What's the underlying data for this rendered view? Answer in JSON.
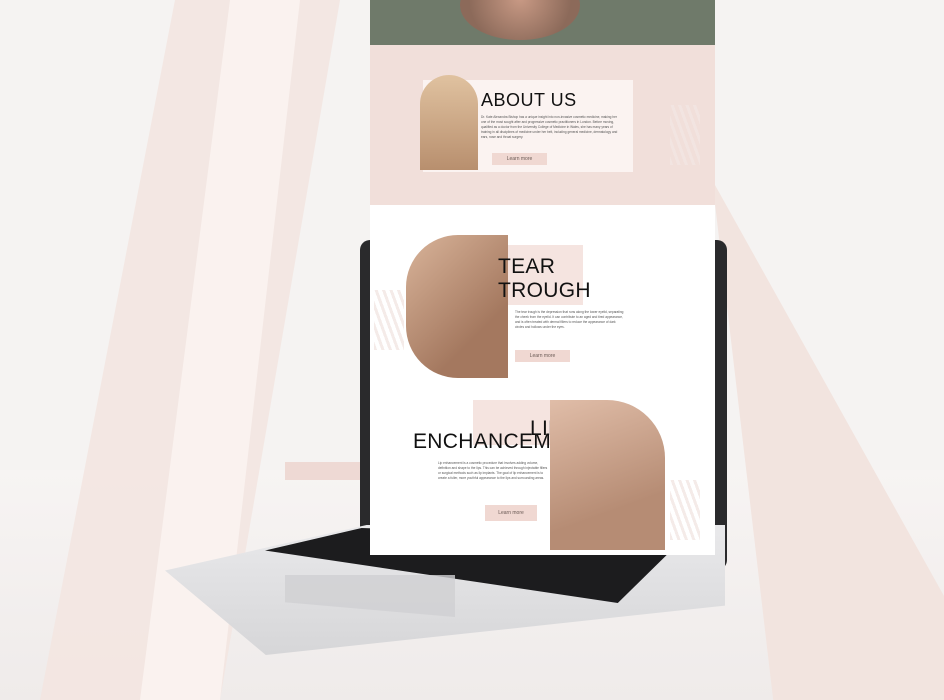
{
  "about": {
    "title": "ABOUT US",
    "text": "Dr. Kate Alexandra Bishop has a unique insight into non-invasive cosmetic medicine, making her one of the most sought after and progressive cosmetic practitioners in London. Before moving, qualified as a doctor from the University College of Medicine in Wales, she has many years of training in all disciplines of medicine under her belt, including general medicine, dermatology and ears, nose and throat surgery.",
    "button": "Learn more"
  },
  "tear": {
    "title_line1": "TEAR",
    "title_line2": "TROUGH",
    "text": "The tear trough is the depression that runs along the lower eyelid, separating the cheek from the eyelid. It can contribute to an aged and tired appearance, and is often treated with dermal fillers to reduce the appearance of dark circles and hollows under the eyes.",
    "button": "Learn more"
  },
  "lip": {
    "title_line1": "LIP",
    "title_line2": "ENCHANCEMENT",
    "text": "Lip enhancement is a cosmetic procedure that involves adding volume, definition and shape to the lips. This can be achieved through injectable fillers or surgical methods such as lip implants. The goal of lip enhancement is to create a fuller, more youthful appearance to the lips and surrounding areas.",
    "button": "Learn more"
  },
  "colors": {
    "accent": "#f0d8d2",
    "hero": "#6f7a6a",
    "about_bg": "#f1dfda"
  }
}
